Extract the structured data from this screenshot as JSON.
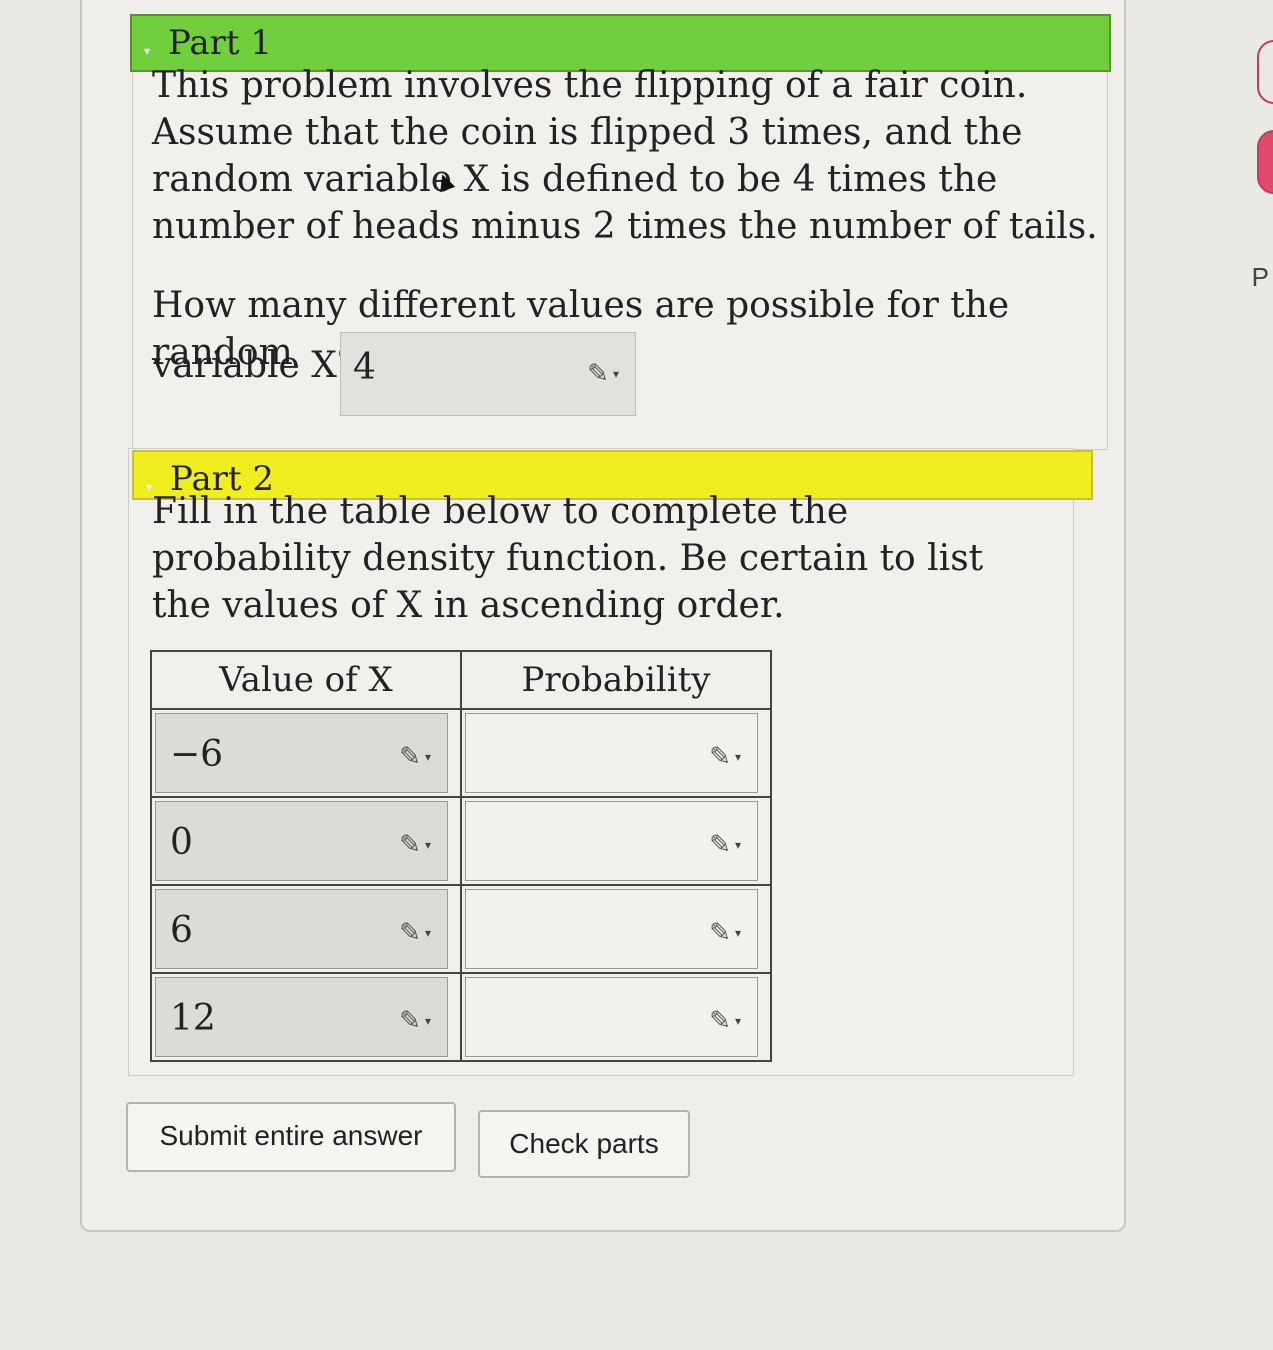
{
  "part1": {
    "header": "Part 1",
    "text": "This problem involves the flipping of a fair coin. Assume that the coin is flipped 3 times, and the random variable X is defined to be 4 times the number of heads minus 2 times the number of tails.",
    "question_line1": "How many different values are possible for the random",
    "question_line2": "variable X?",
    "answer": "4"
  },
  "part2": {
    "header": "Part 2",
    "text": "Fill in the table below to complete the probability density function. Be certain to list the values of X in ascending order.",
    "table": {
      "headers": [
        "Value of X",
        "Probability"
      ],
      "rows": [
        {
          "value": "−6",
          "probability": ""
        },
        {
          "value": "0",
          "probability": ""
        },
        {
          "value": "6",
          "probability": ""
        },
        {
          "value": "12",
          "probability": ""
        }
      ]
    }
  },
  "buttons": {
    "submit": "Submit entire answer",
    "check": "Check parts"
  },
  "edge_label": "P",
  "icons": {
    "edit": "pencil-icon",
    "collapse": "collapse-caret-icon"
  },
  "colors": {
    "part1_header": "#71cf3d",
    "part2_header": "#f0ee1e"
  }
}
